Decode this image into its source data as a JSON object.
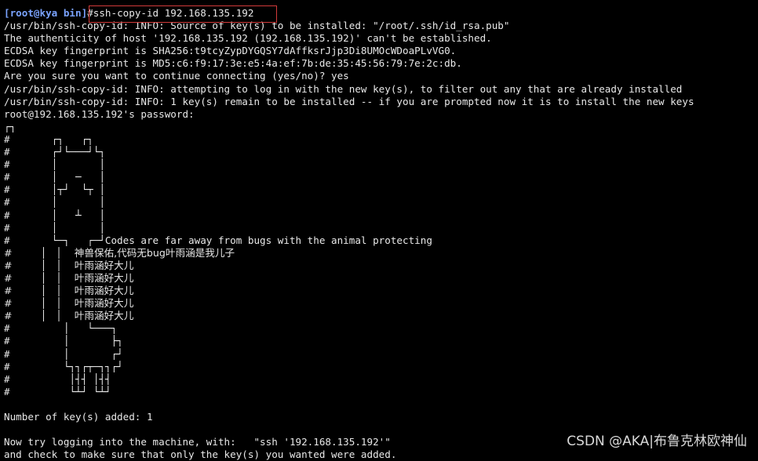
{
  "terminal": {
    "prompt": "[root@kya bin]",
    "command": "#ssh-copy-id 192.168.135.192",
    "output_1": [
      "/usr/bin/ssh-copy-id: INFO: Source of key(s) to be installed: \"/root/.ssh/id_rsa.pub\"",
      "The authenticity of host '192.168.135.192 (192.168.135.192)' can't be established.",
      "ECDSA key fingerprint is SHA256:t9tcyZypDYGQSY7dAffksrJjp3Di8UMOcWDoaPLvVG0.",
      "ECDSA key fingerprint is MD5:c6:f9:17:3e:e5:4a:ef:7b:de:35:45:56:79:7e:2c:db.",
      "Are you sure you want to continue connecting (yes/no)? yes",
      "/usr/bin/ssh-copy-id: INFO: attempting to log in with the new key(s), to filter out any that are already installed",
      "/usr/bin/ssh-copy-id: INFO: 1 key(s) remain to be installed -- if you are prompted now it is to install the new keys",
      "root@192.168.135.192's password:"
    ],
    "banner_art": [
      "┌┐",
      "#       ┌┐   ┌┐",
      "#       ┌┘└───┘└┐",
      "#       │       │",
      "#       │   ─   │",
      "#       │┬┘  └┬ │",
      "#       │       │",
      "#       │   ┴   │",
      "#       │       │",
      "#       └─┐   ┌─┘Codes are far away from bugs with the animal protecting",
      "#         │   │    神兽保佑,代码无bug叶雨涵是我儿子",
      "#         │   │    叶雨涵好大儿",
      "#         │   │    叶雨涵好大儿",
      "#         │   │    叶雨涵好大儿",
      "#         │   │    叶雨涵好大儿",
      "#         │   │    叶雨涵好大儿",
      "#         │   └───┐",
      "#         │       ├┐",
      "#         │       ┌┘",
      "#         └┐┐┌┬─┐┐┌┘",
      "#          │┤┤ │┤┤",
      "#          └┴┘ └┴┘"
    ],
    "output_2": [
      "",
      "Number of key(s) added: 1",
      "",
      "Now try logging into the machine, with:   \"ssh '192.168.135.192'\"",
      "and check to make sure that only the key(s) you wanted were added."
    ]
  },
  "watermark": "CSDN @AKA|布鲁克林欧神仙",
  "colors": {
    "background": "#000000",
    "text": "#e8e8e8",
    "prompt": "#7aa3ff",
    "highlight_box": "#d23a3a"
  }
}
